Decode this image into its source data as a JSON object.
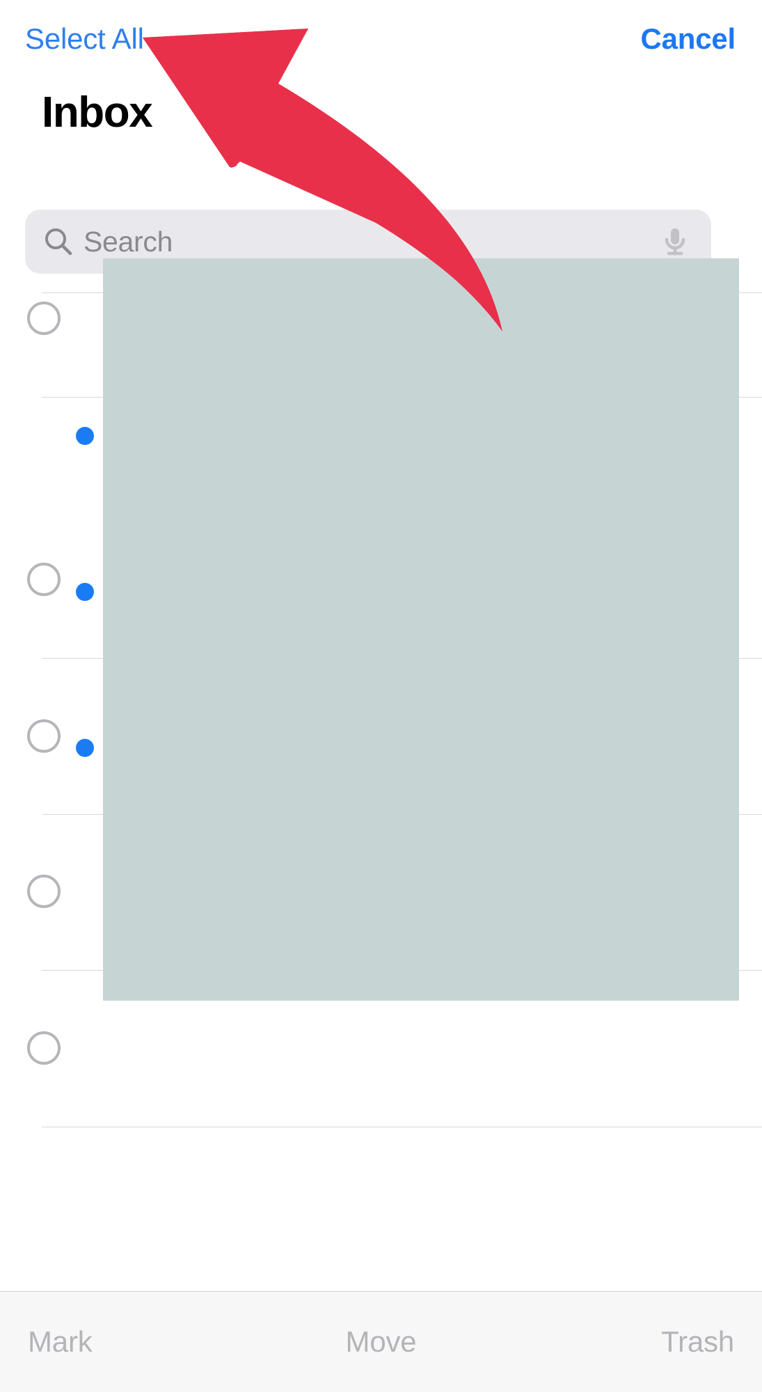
{
  "app": {
    "screen_title": "Inbox",
    "mode": "edit-selection"
  },
  "navbar": {
    "select_all_label": "Select All",
    "cancel_label": "Cancel",
    "tint_color": "#2f7fee"
  },
  "search": {
    "placeholder": "Search",
    "value": "",
    "search_icon": "search-icon",
    "mic_icon": "microphone-icon",
    "field_color": "#e9e9ed",
    "placeholder_color": "#8a8a8e"
  },
  "list": {
    "unread_dot_color": "#1a7cf5",
    "checkbox_border_color": "#b6b6ba",
    "separator_color": "#d8d8dc",
    "rows": [
      {
        "checkbox_state": "unselected",
        "unread": false,
        "content": ""
      },
      {
        "checkbox_state": "unselected",
        "unread": true,
        "content": ""
      },
      {
        "checkbox_state": "unselected",
        "unread": true,
        "content": ""
      },
      {
        "checkbox_state": "unselected",
        "unread": true,
        "content": ""
      },
      {
        "checkbox_state": "unselected",
        "unread": false,
        "content": ""
      }
    ]
  },
  "redaction": {
    "color": "#c6d5d4",
    "label": ""
  },
  "annotation": {
    "arrow_color": "#e8304a",
    "points_to": "Select All"
  },
  "toolbar": {
    "background": "#f7f7f7",
    "disabled_color": "#b4b4b8",
    "buttons": [
      {
        "label": "Mark",
        "enabled": false
      },
      {
        "label": "Move",
        "enabled": false
      },
      {
        "label": "Trash",
        "enabled": false
      }
    ]
  }
}
